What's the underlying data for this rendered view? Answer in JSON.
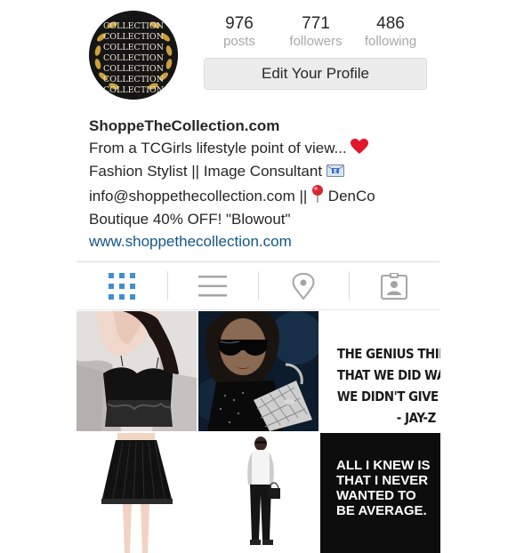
{
  "profile": {
    "stats": [
      {
        "count": "976",
        "label": "posts"
      },
      {
        "count": "771",
        "label": "followers"
      },
      {
        "count": "486",
        "label": "following"
      }
    ],
    "edit_button_label": "Edit Your Profile",
    "avatar_text": "COLLECTION"
  },
  "bio": {
    "name": "ShoppeTheCollection.com",
    "line1": "From a TCGirls lifestyle point of view... ",
    "line2": "Fashion Stylist || Image Consultant ",
    "line3a": "info@shoppethecollection.com || ",
    "line3b": " DenCo",
    "line4": "Boutique 40% OFF! \"Blowout\"",
    "website": "www.shoppethecollection.com"
  },
  "tabs": [
    {
      "icon": "grid-icon",
      "active": true
    },
    {
      "icon": "list-icon",
      "active": false
    },
    {
      "icon": "location-pin-icon",
      "active": false
    },
    {
      "icon": "tagged-photos-icon",
      "active": false
    }
  ],
  "posts": {
    "quote1": [
      "THE GENIUS THING",
      "THAT WE DID WAS,",
      "WE DIDN'T GIVE UP",
      "- JAY-Z"
    ],
    "quote2": [
      "ALL I KNEW IS",
      "THAT I NEVER",
      "WANTED TO",
      "BE AVERAGE."
    ]
  },
  "colors": {
    "link": "#125688",
    "active_tab": "#3f8fd2",
    "inactive_tab": "#a5a5a5",
    "heart": "#e0182c",
    "pin": "#d8262f"
  }
}
